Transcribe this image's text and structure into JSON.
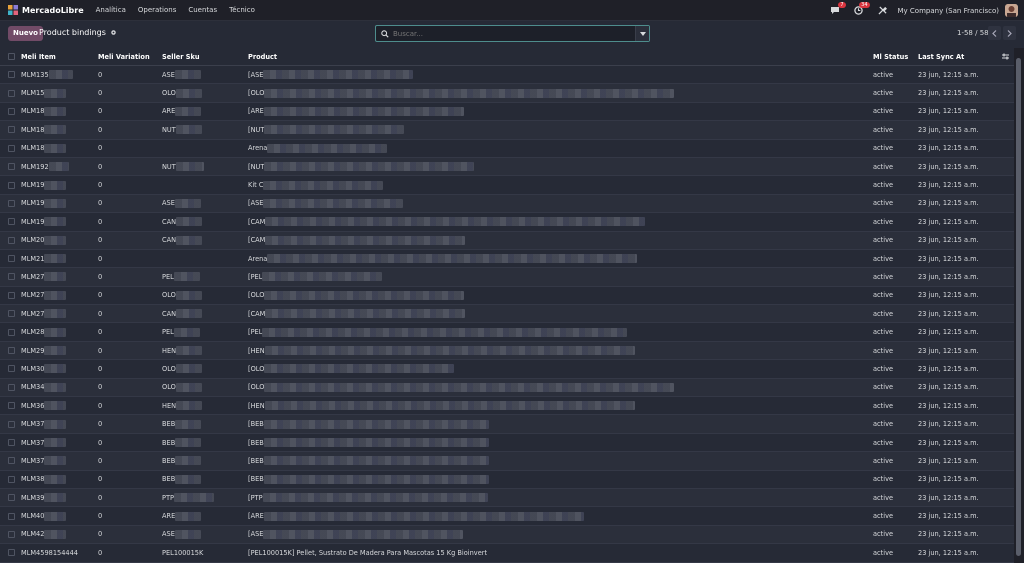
{
  "navbar": {
    "brand": "MercadoLibre",
    "menu": [
      "Analítica",
      "Operations",
      "Cuentas",
      "Técnico"
    ],
    "chat_badge": "7",
    "activity_badge": "34",
    "company": "My Company (San Francisco)"
  },
  "control": {
    "new_label": "Nuevo",
    "title": "Product bindings",
    "search_placeholder": "Buscar...",
    "pager": "1-58 / 58"
  },
  "table": {
    "columns": [
      "Meli Item",
      "Meli Variation",
      "Seller Sku",
      "Product",
      "Ml Status",
      "Last Sync At"
    ],
    "rows": [
      {
        "item": "MLM135",
        "var": "0",
        "sku": "ASE",
        "prod": "[ASE",
        "status": "active",
        "sync": "23 jun, 12:15 a.m."
      },
      {
        "item": "MLM15",
        "var": "0",
        "sku": "OLO",
        "prod": "[OLO",
        "status": "active",
        "sync": "23 jun, 12:15 a.m."
      },
      {
        "item": "MLM18",
        "var": "0",
        "sku": "ARE",
        "prod": "[ARE",
        "status": "active",
        "sync": "23 jun, 12:15 a.m."
      },
      {
        "item": "MLM18",
        "var": "0",
        "sku": "NUT",
        "prod": "[NUT",
        "status": "active",
        "sync": "23 jun, 12:15 a.m."
      },
      {
        "item": "MLM18",
        "var": "0",
        "sku": "",
        "prod": "Arena",
        "status": "active",
        "sync": "23 jun, 12:15 a.m."
      },
      {
        "item": "MLM192",
        "var": "0",
        "sku": "NUT",
        "prod": "[NUT",
        "status": "active",
        "sync": "23 jun, 12:15 a.m."
      },
      {
        "item": "MLM19",
        "var": "0",
        "sku": "",
        "prod": "Kit C",
        "status": "active",
        "sync": "23 jun, 12:15 a.m."
      },
      {
        "item": "MLM19",
        "var": "0",
        "sku": "ASE",
        "prod": "[ASE",
        "status": "active",
        "sync": "23 jun, 12:15 a.m."
      },
      {
        "item": "MLM19",
        "var": "0",
        "sku": "CAN",
        "prod": "[CAM",
        "status": "active",
        "sync": "23 jun, 12:15 a.m."
      },
      {
        "item": "MLM20",
        "var": "0",
        "sku": "CAN",
        "prod": "[CAM",
        "status": "active",
        "sync": "23 jun, 12:15 a.m."
      },
      {
        "item": "MLM21",
        "var": "0",
        "sku": "",
        "prod": "Arena",
        "status": "active",
        "sync": "23 jun, 12:15 a.m."
      },
      {
        "item": "MLM27",
        "var": "0",
        "sku": "PEL",
        "prod": "[PEL",
        "status": "active",
        "sync": "23 jun, 12:15 a.m."
      },
      {
        "item": "MLM27",
        "var": "0",
        "sku": "OLO",
        "prod": "[OLO",
        "status": "active",
        "sync": "23 jun, 12:15 a.m."
      },
      {
        "item": "MLM27",
        "var": "0",
        "sku": "CAN",
        "prod": "[CAM",
        "status": "active",
        "sync": "23 jun, 12:15 a.m."
      },
      {
        "item": "MLM28",
        "var": "0",
        "sku": "PEL",
        "prod": "[PEL",
        "status": "active",
        "sync": "23 jun, 12:15 a.m."
      },
      {
        "item": "MLM29",
        "var": "0",
        "sku": "HEN",
        "prod": "[HEN",
        "status": "active",
        "sync": "23 jun, 12:15 a.m."
      },
      {
        "item": "MLM30",
        "var": "0",
        "sku": "OLO",
        "prod": "[OLO",
        "status": "active",
        "sync": "23 jun, 12:15 a.m."
      },
      {
        "item": "MLM34",
        "var": "0",
        "sku": "OLO",
        "prod": "[OLO",
        "status": "active",
        "sync": "23 jun, 12:15 a.m."
      },
      {
        "item": "MLM36",
        "var": "0",
        "sku": "HEN",
        "prod": "[HEN",
        "status": "active",
        "sync": "23 jun, 12:15 a.m."
      },
      {
        "item": "MLM37",
        "var": "0",
        "sku": "BEB",
        "prod": "[BEB",
        "status": "active",
        "sync": "23 jun, 12:15 a.m."
      },
      {
        "item": "MLM37",
        "var": "0",
        "sku": "BEB",
        "prod": "[BEB",
        "status": "active",
        "sync": "23 jun, 12:15 a.m."
      },
      {
        "item": "MLM37",
        "var": "0",
        "sku": "BEB",
        "prod": "[BEB",
        "status": "active",
        "sync": "23 jun, 12:15 a.m."
      },
      {
        "item": "MLM38",
        "var": "0",
        "sku": "BEB",
        "prod": "[BEB",
        "status": "active",
        "sync": "23 jun, 12:15 a.m."
      },
      {
        "item": "MLM39",
        "var": "0",
        "sku": "PTP",
        "prod": "[PTP",
        "status": "active",
        "sync": "23 jun, 12:15 a.m."
      },
      {
        "item": "MLM40",
        "var": "0",
        "sku": "ARE",
        "prod": "[ARE",
        "status": "active",
        "sync": "23 jun, 12:15 a.m."
      },
      {
        "item": "MLM42",
        "var": "0",
        "sku": "ASE",
        "prod": "[ASE",
        "status": "active",
        "sync": "23 jun, 12:15 a.m."
      },
      {
        "item": "MLM4598154444",
        "var": "0",
        "sku": "PEL100015K",
        "prod": "[PEL100015K] Pellet, Sustrato De Madera Para Mascotas 15 Kg Bioinvert",
        "status": "active",
        "sync": "23 jun, 12:15 a.m."
      }
    ]
  }
}
